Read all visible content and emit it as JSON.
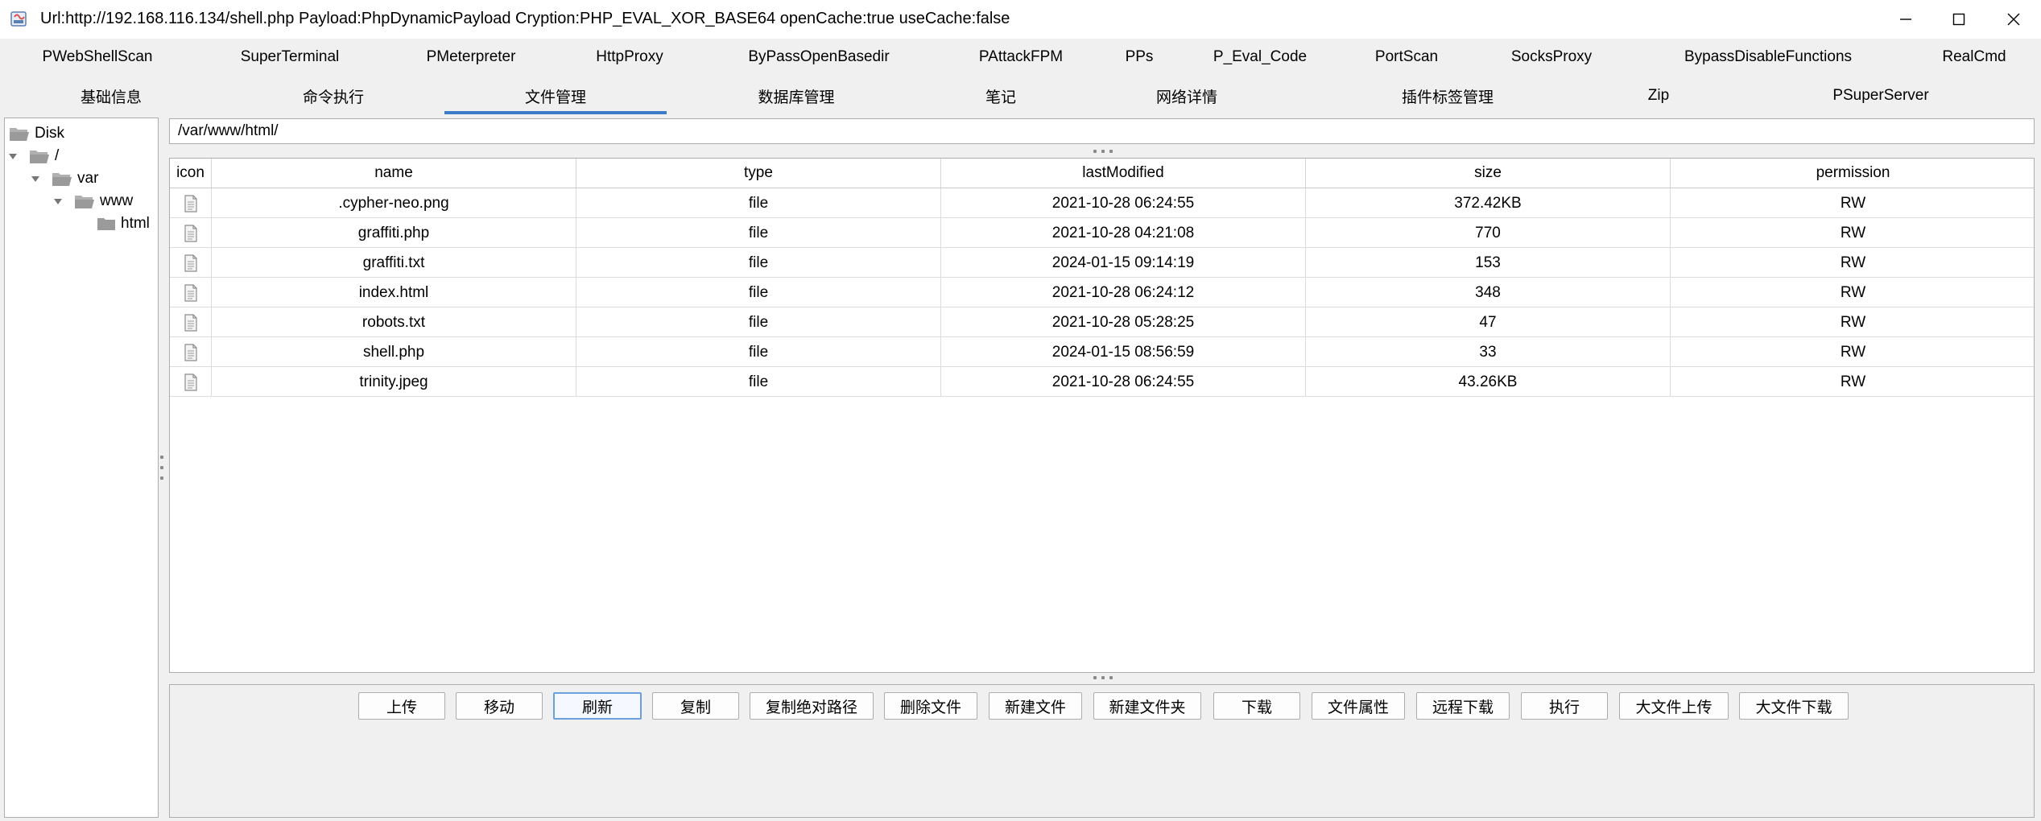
{
  "window": {
    "title": "Url:http://192.168.116.134/shell.php Payload:PhpDynamicPayload Cryption:PHP_EVAL_XOR_BASE64 openCache:true useCache:false"
  },
  "plugin_tabs": [
    {
      "label": "PWebShellScan"
    },
    {
      "label": "SuperTerminal"
    },
    {
      "label": "PMeterpreter"
    },
    {
      "label": "HttpProxy"
    },
    {
      "label": "ByPassOpenBasedir"
    },
    {
      "label": "PAttackFPM"
    },
    {
      "label": "PPs"
    },
    {
      "label": "P_Eval_Code"
    },
    {
      "label": "PortScan"
    },
    {
      "label": "SocksProxy"
    },
    {
      "label": "BypassDisableFunctions"
    },
    {
      "label": "RealCmd"
    }
  ],
  "main_tabs": [
    {
      "label": "基础信息"
    },
    {
      "label": "命令执行"
    },
    {
      "label": "文件管理",
      "selected": true
    },
    {
      "label": "数据库管理"
    },
    {
      "label": "笔记"
    },
    {
      "label": "网络详情"
    },
    {
      "label": "插件标签管理"
    },
    {
      "label": "Zip"
    },
    {
      "label": "PSuperServer"
    }
  ],
  "tree": {
    "nodes": [
      {
        "label": "Disk"
      },
      {
        "label": "/"
      },
      {
        "label": "var"
      },
      {
        "label": "www"
      },
      {
        "label": "html"
      }
    ]
  },
  "path": {
    "value": "/var/www/html/"
  },
  "file_table": {
    "columns": [
      "icon",
      "name",
      "type",
      "lastModified",
      "size",
      "permission"
    ],
    "rows": [
      {
        "name": ".cypher-neo.png",
        "type": "file",
        "lastModified": "2021-10-28 06:24:55",
        "size": "372.42KB",
        "permission": "RW"
      },
      {
        "name": "graffiti.php",
        "type": "file",
        "lastModified": "2021-10-28 04:21:08",
        "size": "770",
        "permission": "RW"
      },
      {
        "name": "graffiti.txt",
        "type": "file",
        "lastModified": "2024-01-15 09:14:19",
        "size": "153",
        "permission": "RW"
      },
      {
        "name": "index.html",
        "type": "file",
        "lastModified": "2021-10-28 06:24:12",
        "size": "348",
        "permission": "RW"
      },
      {
        "name": "robots.txt",
        "type": "file",
        "lastModified": "2021-10-28 05:28:25",
        "size": "47",
        "permission": "RW"
      },
      {
        "name": "shell.php",
        "type": "file",
        "lastModified": "2024-01-15 08:56:59",
        "size": "33",
        "permission": "RW"
      },
      {
        "name": "trinity.jpeg",
        "type": "file",
        "lastModified": "2021-10-28 06:24:55",
        "size": "43.26KB",
        "permission": "RW"
      }
    ]
  },
  "actions": [
    {
      "label": "上传"
    },
    {
      "label": "移动"
    },
    {
      "label": "刷新",
      "focused": true
    },
    {
      "label": "复制"
    },
    {
      "label": "复制绝对路径"
    },
    {
      "label": "删除文件"
    },
    {
      "label": "新建文件"
    },
    {
      "label": "新建文件夹"
    },
    {
      "label": "下载"
    },
    {
      "label": "文件属性"
    },
    {
      "label": "远程下载"
    },
    {
      "label": "执行"
    },
    {
      "label": "大文件上传"
    },
    {
      "label": "大文件下载"
    }
  ],
  "colors": {
    "accent": "#3d7cc9",
    "focus_border": "#6aa1dc",
    "folder": "#9a9a9a"
  }
}
